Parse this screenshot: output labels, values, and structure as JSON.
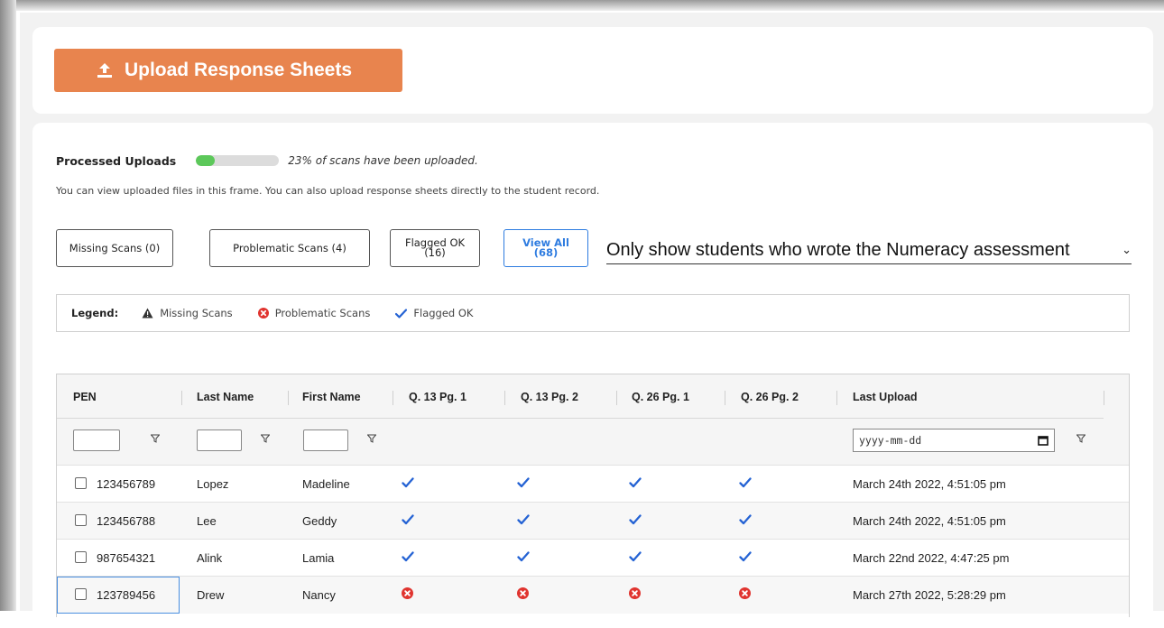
{
  "upload": {
    "label": "Upload Response Sheets"
  },
  "processed": {
    "label": "Processed Uploads",
    "progress_fraction": 0.23,
    "progress_text": "23% of scans have been uploaded.",
    "info": "You can view uploaded files in this frame. You can also upload response sheets directly to the student record."
  },
  "filters": {
    "missing": "Missing Scans (0)",
    "problematic": "Problematic Scans (4)",
    "flagged_line1": "Flagged OK",
    "flagged_line2": "(16)",
    "viewall_line1": "View All",
    "viewall_line2": "(68)",
    "select_value": "Only show students who wrote the Numeracy assessment"
  },
  "legend": {
    "title": "Legend:",
    "missing": "Missing Scans",
    "problematic": "Problematic Scans",
    "flagged": "Flagged OK"
  },
  "table": {
    "headers": [
      "PEN",
      "Last Name",
      "First Name",
      "Q. 13 Pg. 1",
      "Q. 13 Pg. 2",
      "Q. 26 Pg. 1",
      "Q. 26 Pg. 2",
      "Last Upload"
    ],
    "date_placeholder": "yyyy-mm-dd",
    "rows": [
      {
        "pen": "123456789",
        "last": "Lopez",
        "first": "Madeline",
        "status": [
          "ok",
          "ok",
          "ok",
          "ok"
        ],
        "upload": "March 24th 2022, 4:51:05 pm"
      },
      {
        "pen": "123456788",
        "last": "Lee",
        "first": "Geddy",
        "status": [
          "ok",
          "ok",
          "ok",
          "ok"
        ],
        "upload": "March 24th 2022, 4:51:05 pm"
      },
      {
        "pen": "987654321",
        "last": "Alink",
        "first": "Lamia",
        "status": [
          "ok",
          "ok",
          "ok",
          "ok"
        ],
        "upload": "March 22nd 2022, 4:47:25 pm"
      },
      {
        "pen": "123789456",
        "last": "Drew",
        "first": "Nancy",
        "status": [
          "error",
          "error",
          "error",
          "error"
        ],
        "upload": "March 27th 2022, 5:28:29 pm"
      }
    ]
  },
  "colors": {
    "upload_button": "#e8844e",
    "progress": "#5cc85a",
    "accent": "#2e7ce0",
    "check": "#2563d4",
    "error": "#e0342f"
  }
}
